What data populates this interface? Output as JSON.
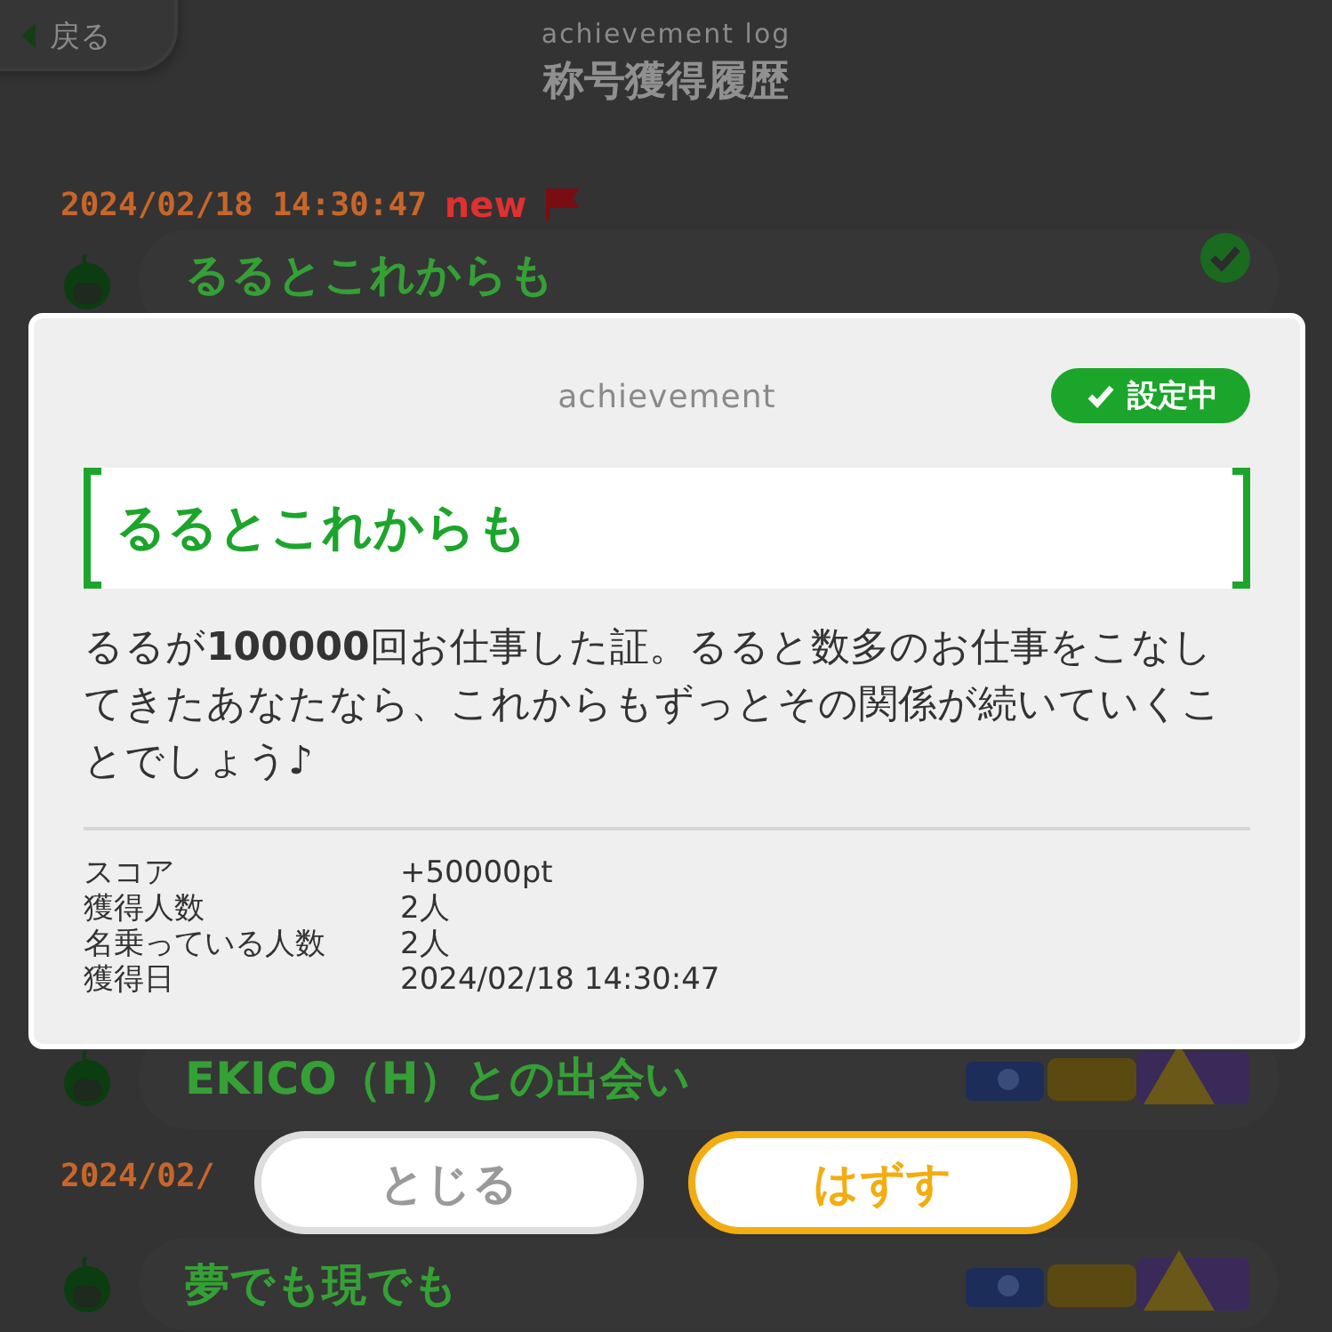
{
  "header": {
    "back_label": "戻る",
    "subtitle": "achievement log",
    "title": "称号獲得履歴"
  },
  "log": [
    {
      "kind": "date",
      "text": "2024/02/18 14:30:47",
      "new_label": "new"
    },
    {
      "kind": "item",
      "title": "るるとこれからも",
      "equipped": true
    },
    {
      "kind": "item",
      "title": "EKICO（H）との出会い",
      "equipped": false
    },
    {
      "kind": "date",
      "text": "2024/02/"
    },
    {
      "kind": "item",
      "title": "夢でも現でも",
      "equipped": false
    }
  ],
  "dialog": {
    "heading": "achievement",
    "badge": "設定中",
    "title": "るるとこれからも",
    "description": "るるが**100000**回お仕事した証。るると数多のお仕事をこなしてきたあなたなら、これからもずっとその関係が続いていくことでしょう♪",
    "stats": [
      {
        "label": "スコア",
        "value": "+50000pt"
      },
      {
        "label": "獲得人数",
        "value": "2人"
      },
      {
        "label": "名乗っている人数",
        "value": "2人"
      },
      {
        "label": "獲得日",
        "value": "2024/02/18 14:30:47"
      }
    ]
  },
  "buttons": [
    {
      "label": "とじる",
      "kind": "secondary"
    },
    {
      "label": "はずす",
      "kind": "primary"
    }
  ]
}
